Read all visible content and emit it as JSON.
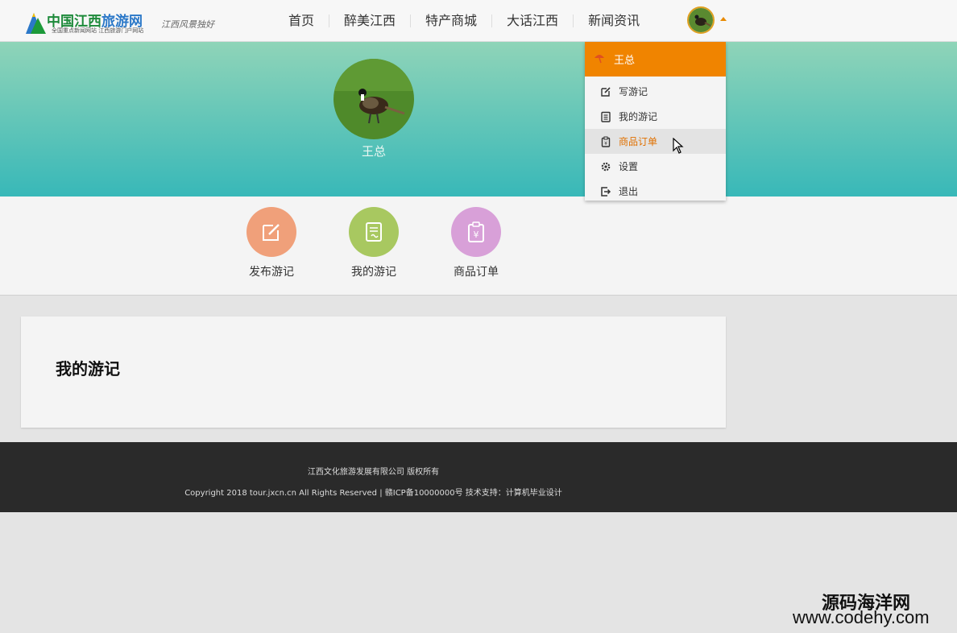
{
  "header": {
    "logo_title_a": "中国江西",
    "logo_title_b": "旅游网",
    "logo_sub": "全国重点新闻网站 江西旅游门户网站",
    "logo_slogan": "江西风景独好",
    "nav": [
      {
        "label": "首页"
      },
      {
        "label": "醉美江西"
      },
      {
        "label": "特产商城"
      },
      {
        "label": "大话江西"
      },
      {
        "label": "新闻资讯"
      }
    ]
  },
  "profile": {
    "username": "王总"
  },
  "actions": [
    {
      "label": "发布游记",
      "icon": "edit-icon",
      "color": "#f0a07a"
    },
    {
      "label": "我的游记",
      "icon": "notes-icon",
      "color": "#a8c860"
    },
    {
      "label": "商品订单",
      "icon": "order-clipboard-icon",
      "color": "#d8a0d8"
    }
  ],
  "card": {
    "title": "我的游记"
  },
  "footer": {
    "line1": "江西文化旅游发展有限公司 版权所有",
    "line2": "Copyright 2018 tour.jxcn.cn All Rights Reserved | 赣ICP备10000000号 技术支持：计算机毕业设计"
  },
  "dropdown": {
    "header_name": "王总",
    "items": [
      {
        "label": "写游记",
        "icon": "edit-icon"
      },
      {
        "label": "我的游记",
        "icon": "list-icon"
      },
      {
        "label": "商品订单",
        "icon": "order-clipboard-icon",
        "active": true
      },
      {
        "label": "设置",
        "icon": "gear-icon"
      },
      {
        "label": "退出",
        "icon": "logout-icon"
      }
    ]
  },
  "watermark": {
    "line1": "源码海洋网",
    "line2": "www.codehy.com"
  },
  "colors": {
    "accent": "#f08400",
    "banner_top": "#8fd4b8",
    "banner_bottom": "#38b8b8",
    "footer_bg": "#2a2a2a"
  }
}
